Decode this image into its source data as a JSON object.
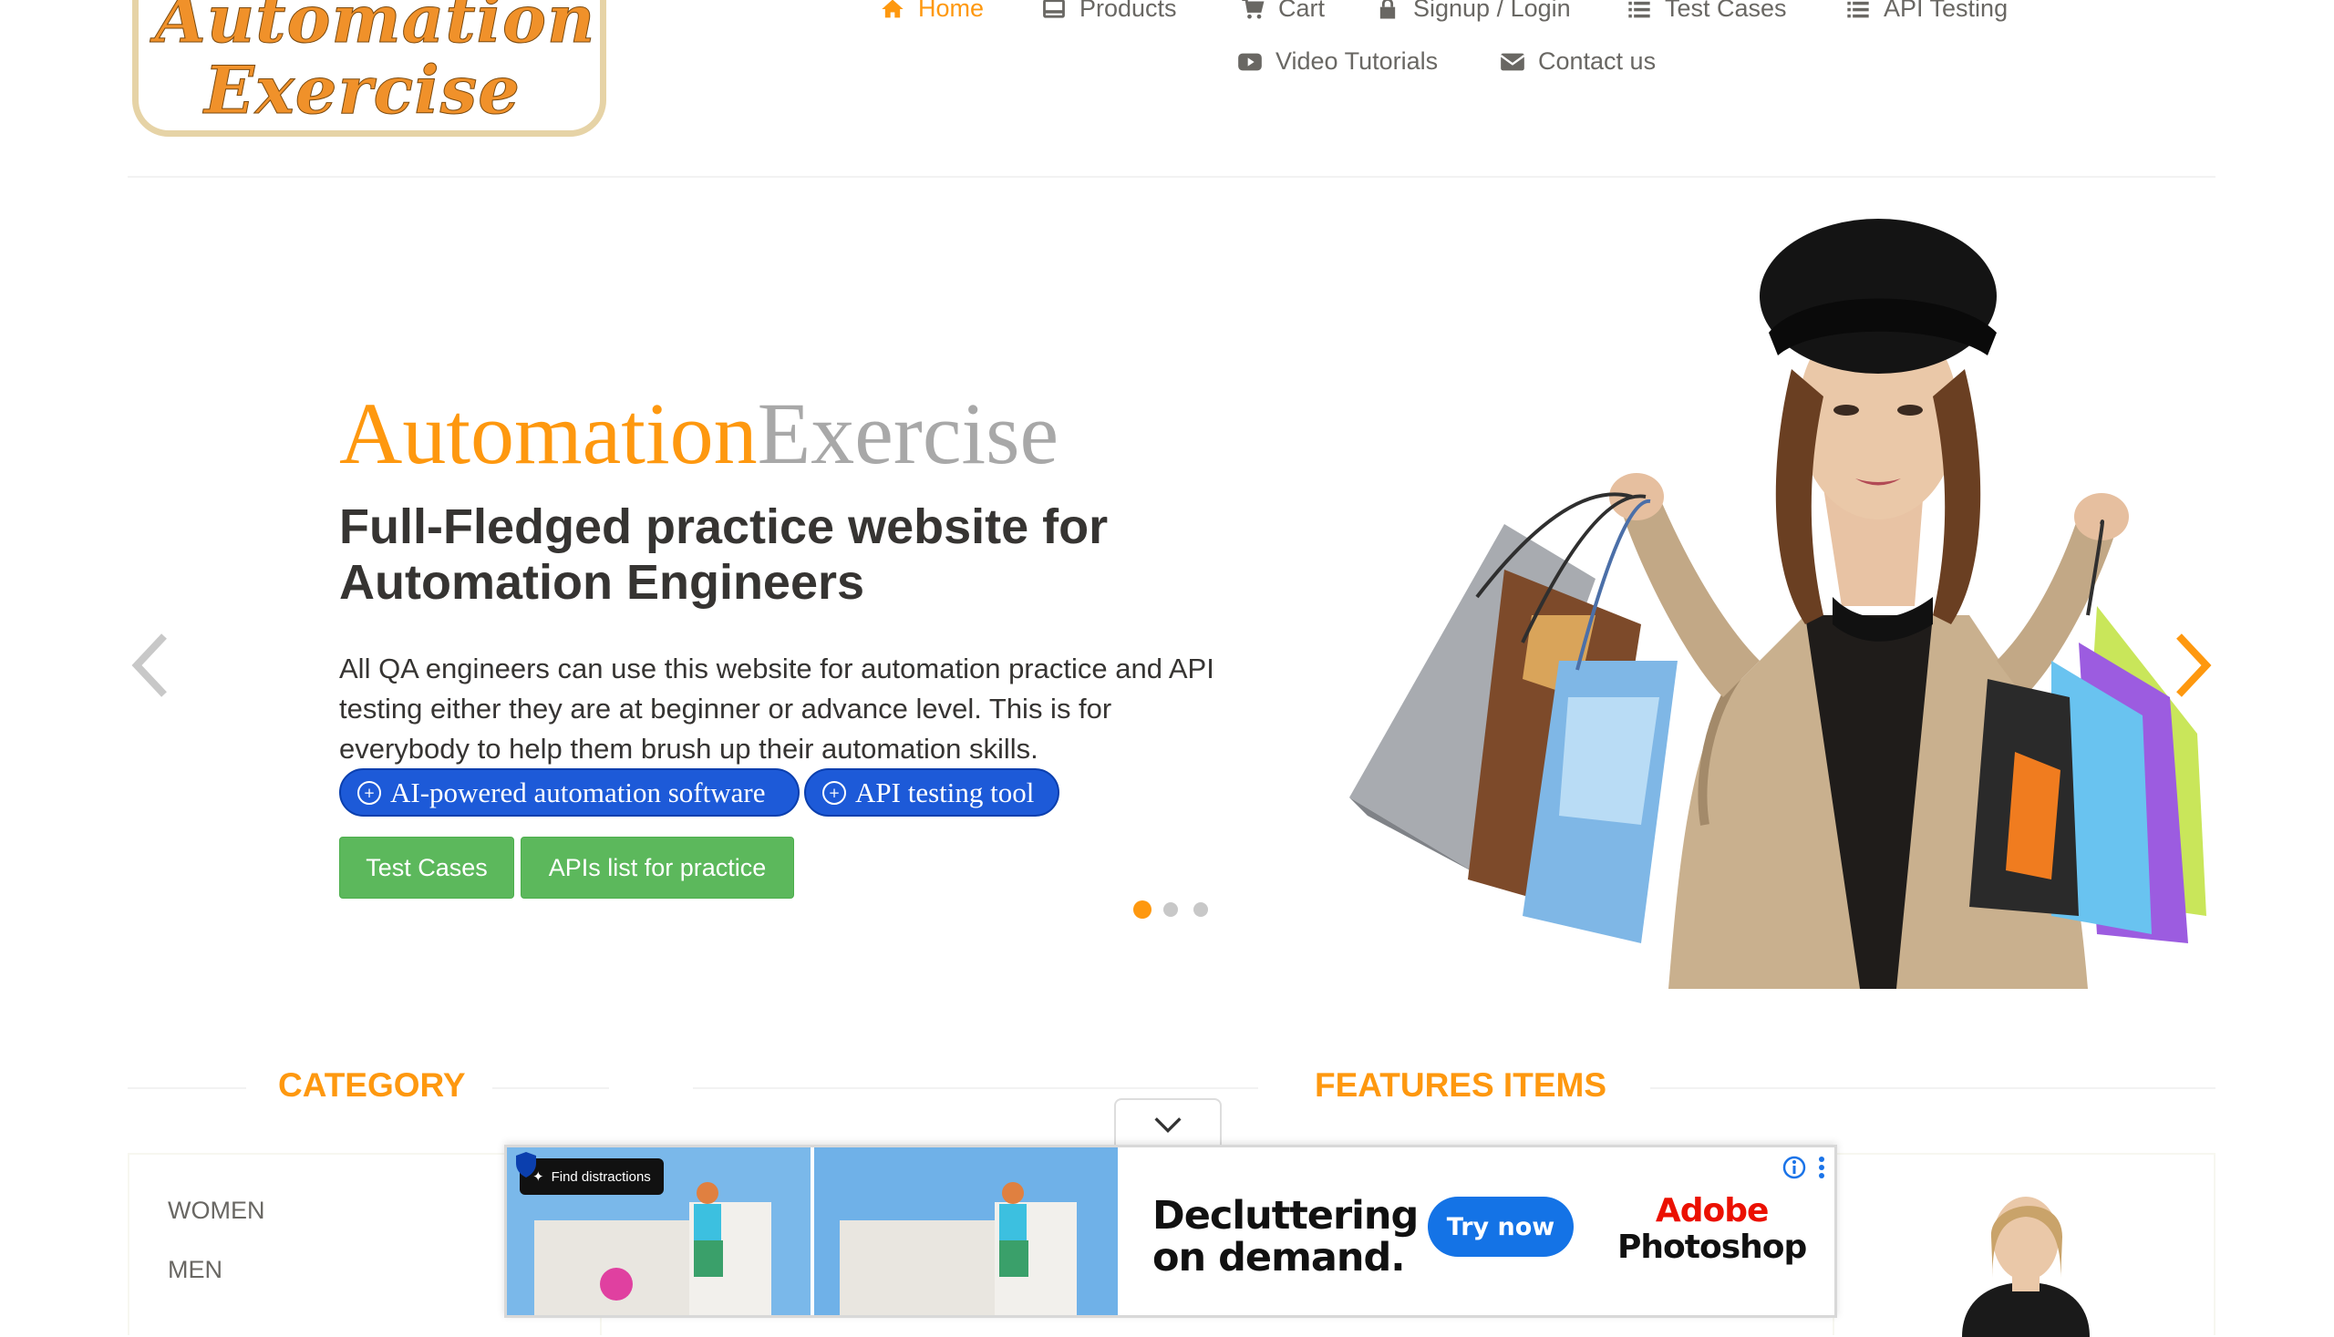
{
  "logo": {
    "line1": "Automation",
    "line2": "Exercise"
  },
  "nav": {
    "home": "Home",
    "products": "Products",
    "cart": "Cart",
    "signup": "Signup / Login",
    "test_cases": "Test Cases",
    "api_testing": "API Testing",
    "video_tutorials": "Video Tutorials",
    "contact_us": "Contact us"
  },
  "slider": {
    "brand_part1": "Automation",
    "brand_part2": "Exercise",
    "heading": "Full-Fledged practice website for Automation Engineers",
    "description": "All QA engineers can use this website for automation practice and API testing either they are at beginner or advance level. This is for everybody to help them brush up their automation skills.",
    "pill_ai": "AI-powered automation software",
    "pill_api": "API testing tool",
    "btn_test_cases": "Test Cases",
    "btn_apis": "APIs list for practice",
    "active_slide": 1,
    "slide_count": 3
  },
  "sections": {
    "category_title": "CATEGORY",
    "features_title": "FEATURES ITEMS"
  },
  "categories": [
    "WOMEN",
    "MEN"
  ],
  "ad": {
    "find_label": "Find distractions",
    "headline_line1": "Decluttering",
    "headline_line2": "on demand.",
    "cta": "Try now",
    "brand_line1": "Adobe",
    "brand_line2": "Photoshop"
  },
  "colors": {
    "accent": "#fe980f",
    "green": "#5cb85c",
    "pill_blue": "#1d5ad8",
    "ad_blue": "#1473e6",
    "adobe_red": "#eb1000"
  }
}
